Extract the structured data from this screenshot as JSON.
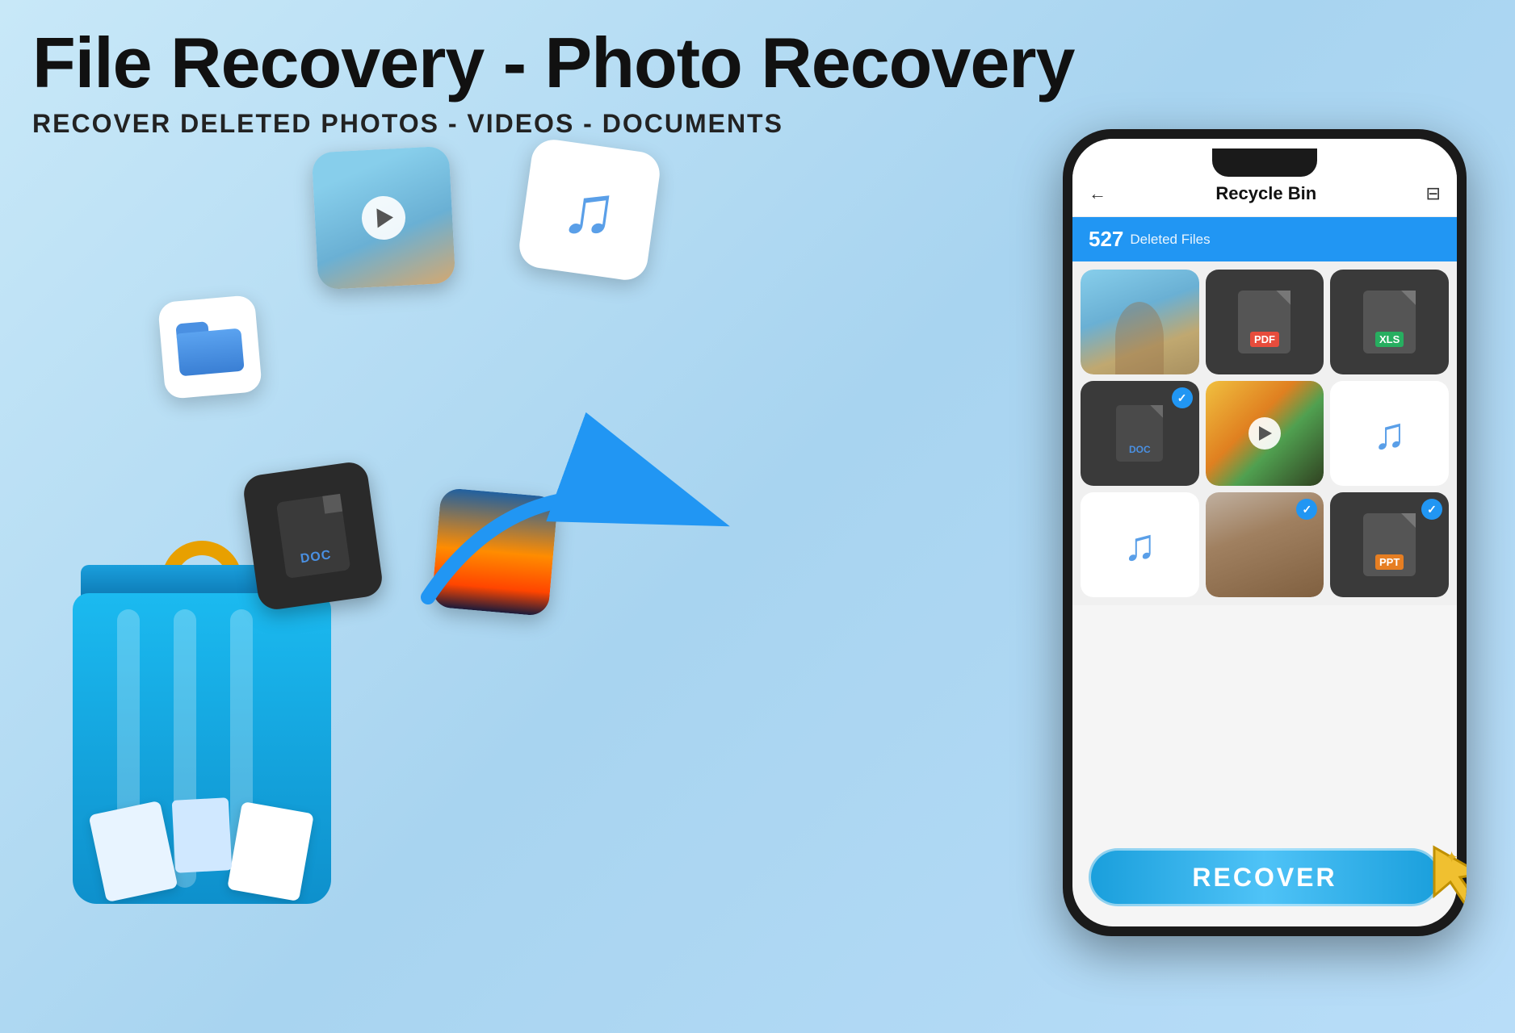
{
  "header": {
    "main_title": "File Recovery - Photo Recovery",
    "sub_title": "RECOVER DELETED PHOTOS - VIDEOS - DOCUMENTS"
  },
  "phone": {
    "app_header": {
      "back_label": "←",
      "title": "Recycle Bin",
      "filter_label": "≡"
    },
    "deleted_bar": {
      "count": "527",
      "label": "Deleted Files"
    },
    "grid": {
      "cells": [
        {
          "type": "photo",
          "theme": "girl-blue",
          "checked": false
        },
        {
          "type": "pdf",
          "label": "PDF",
          "checked": false
        },
        {
          "type": "xls",
          "label": "XLS",
          "checked": false
        },
        {
          "type": "doc",
          "label": "DOC",
          "checked": true
        },
        {
          "type": "video",
          "theme": "flower",
          "checked": false
        },
        {
          "type": "music",
          "checked": false
        },
        {
          "type": "music",
          "checked": false
        },
        {
          "type": "photo",
          "theme": "guy",
          "checked": true
        },
        {
          "type": "ppt",
          "label": "PPT",
          "checked": true
        }
      ]
    },
    "recover_button": {
      "label": "RECOVER"
    }
  },
  "floating_icons": {
    "folder_label": "folder",
    "music_label": "music",
    "doc1_label": "DOC",
    "doc2_label": "DOC"
  },
  "icons": {
    "back_arrow": "←",
    "filter": "⊟",
    "check": "✓",
    "play": "▶",
    "music_note": "♫",
    "cursor": "🖱"
  }
}
